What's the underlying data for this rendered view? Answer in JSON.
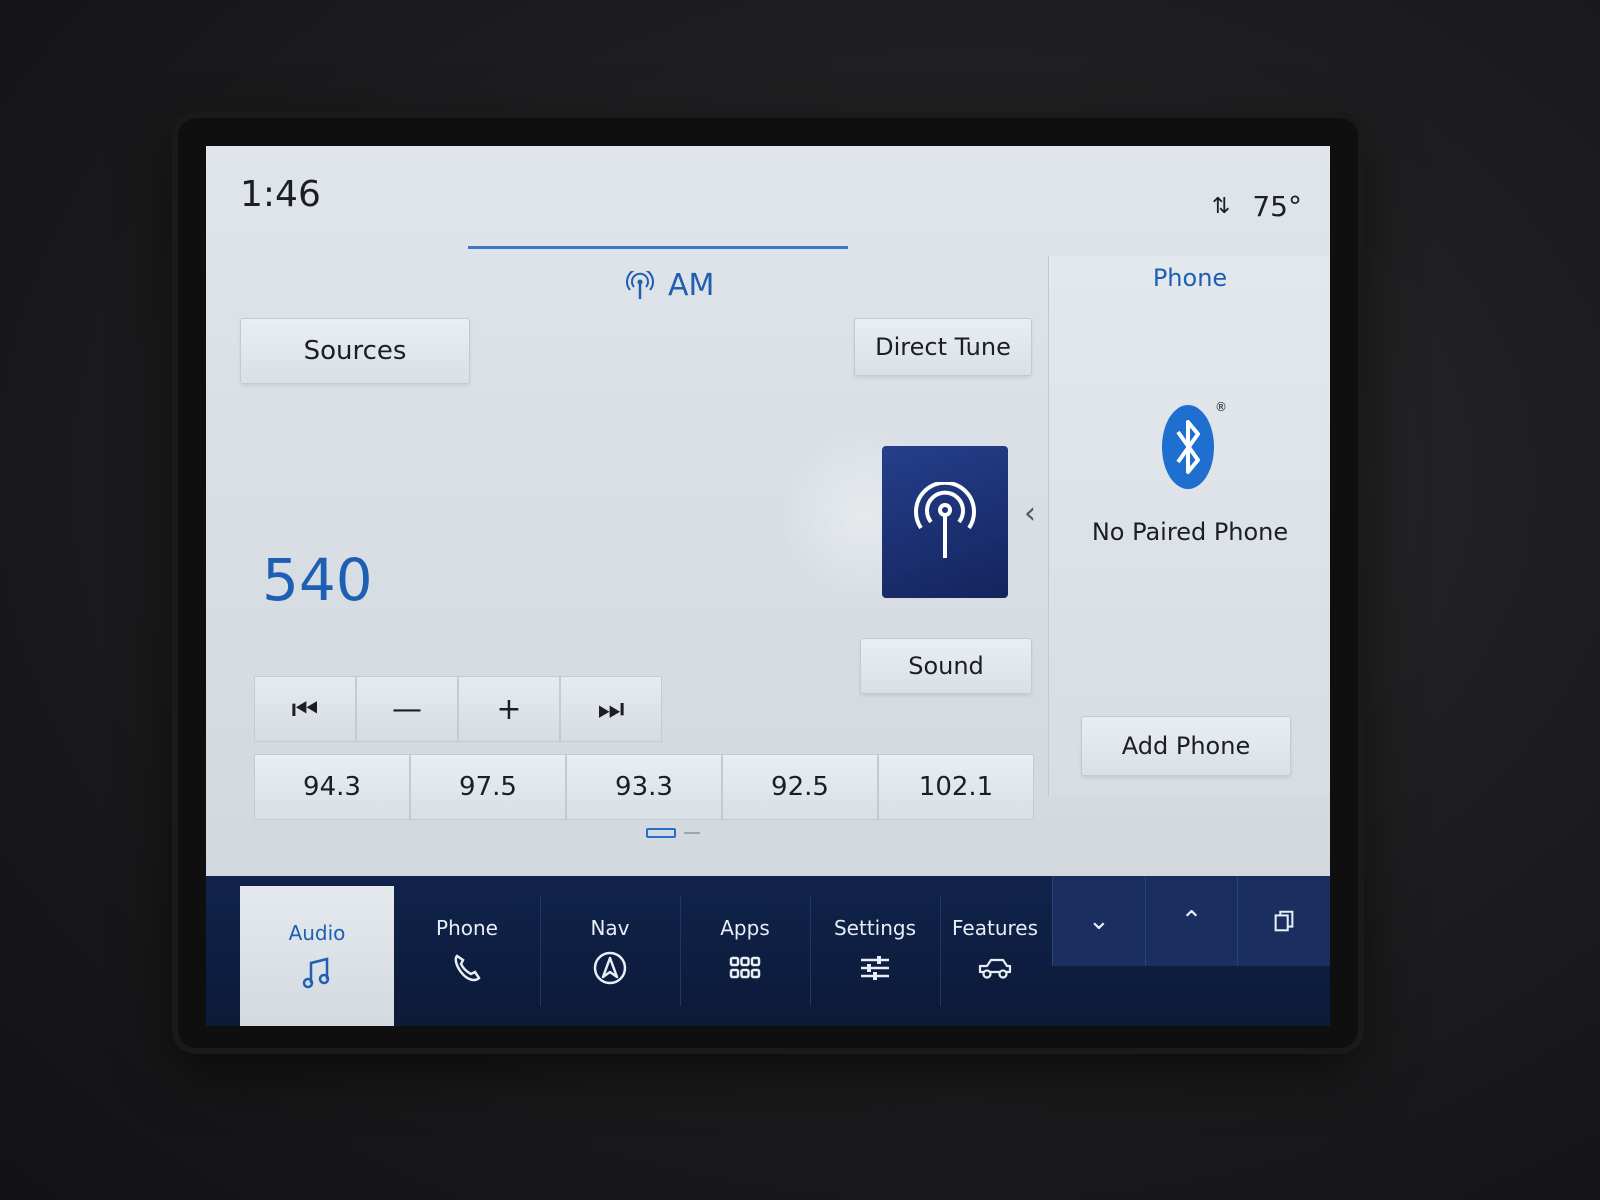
{
  "status": {
    "time": "1:46",
    "temperature": "75°"
  },
  "source": {
    "band": "AM",
    "frequency": "540"
  },
  "buttons": {
    "sources": "Sources",
    "direct_tune": "Direct Tune",
    "sound": "Sound"
  },
  "transport": {
    "seek_back": "⏮",
    "tune_down": "—",
    "tune_up": "+",
    "seek_forward": "⏭"
  },
  "presets": [
    "94.3",
    "97.5",
    "93.3",
    "92.5",
    "102.1"
  ],
  "phone_panel": {
    "title": "Phone",
    "status": "No Paired Phone",
    "add_button": "Add Phone"
  },
  "nav": {
    "audio": "Audio",
    "phone": "Phone",
    "nav": "Nav",
    "apps": "Apps",
    "settings": "Settings",
    "features": "Features"
  },
  "icons": {
    "sync": "sync-arrows-icon",
    "antenna": "antenna-icon",
    "bluetooth": "bluetooth-icon",
    "audio": "music-note-icon",
    "phone": "phone-handset-icon",
    "nav": "compass-arrow-icon",
    "apps": "grid-icon",
    "settings": "sliders-icon",
    "features": "truck-icon",
    "collapse": "chevron-down-icon",
    "expand": "chevron-up-icon",
    "windows": "copy-windows-icon"
  },
  "colors": {
    "accent": "#1e5fb3",
    "nav_bg": "#10234b",
    "art_bg": "#1f3580"
  }
}
